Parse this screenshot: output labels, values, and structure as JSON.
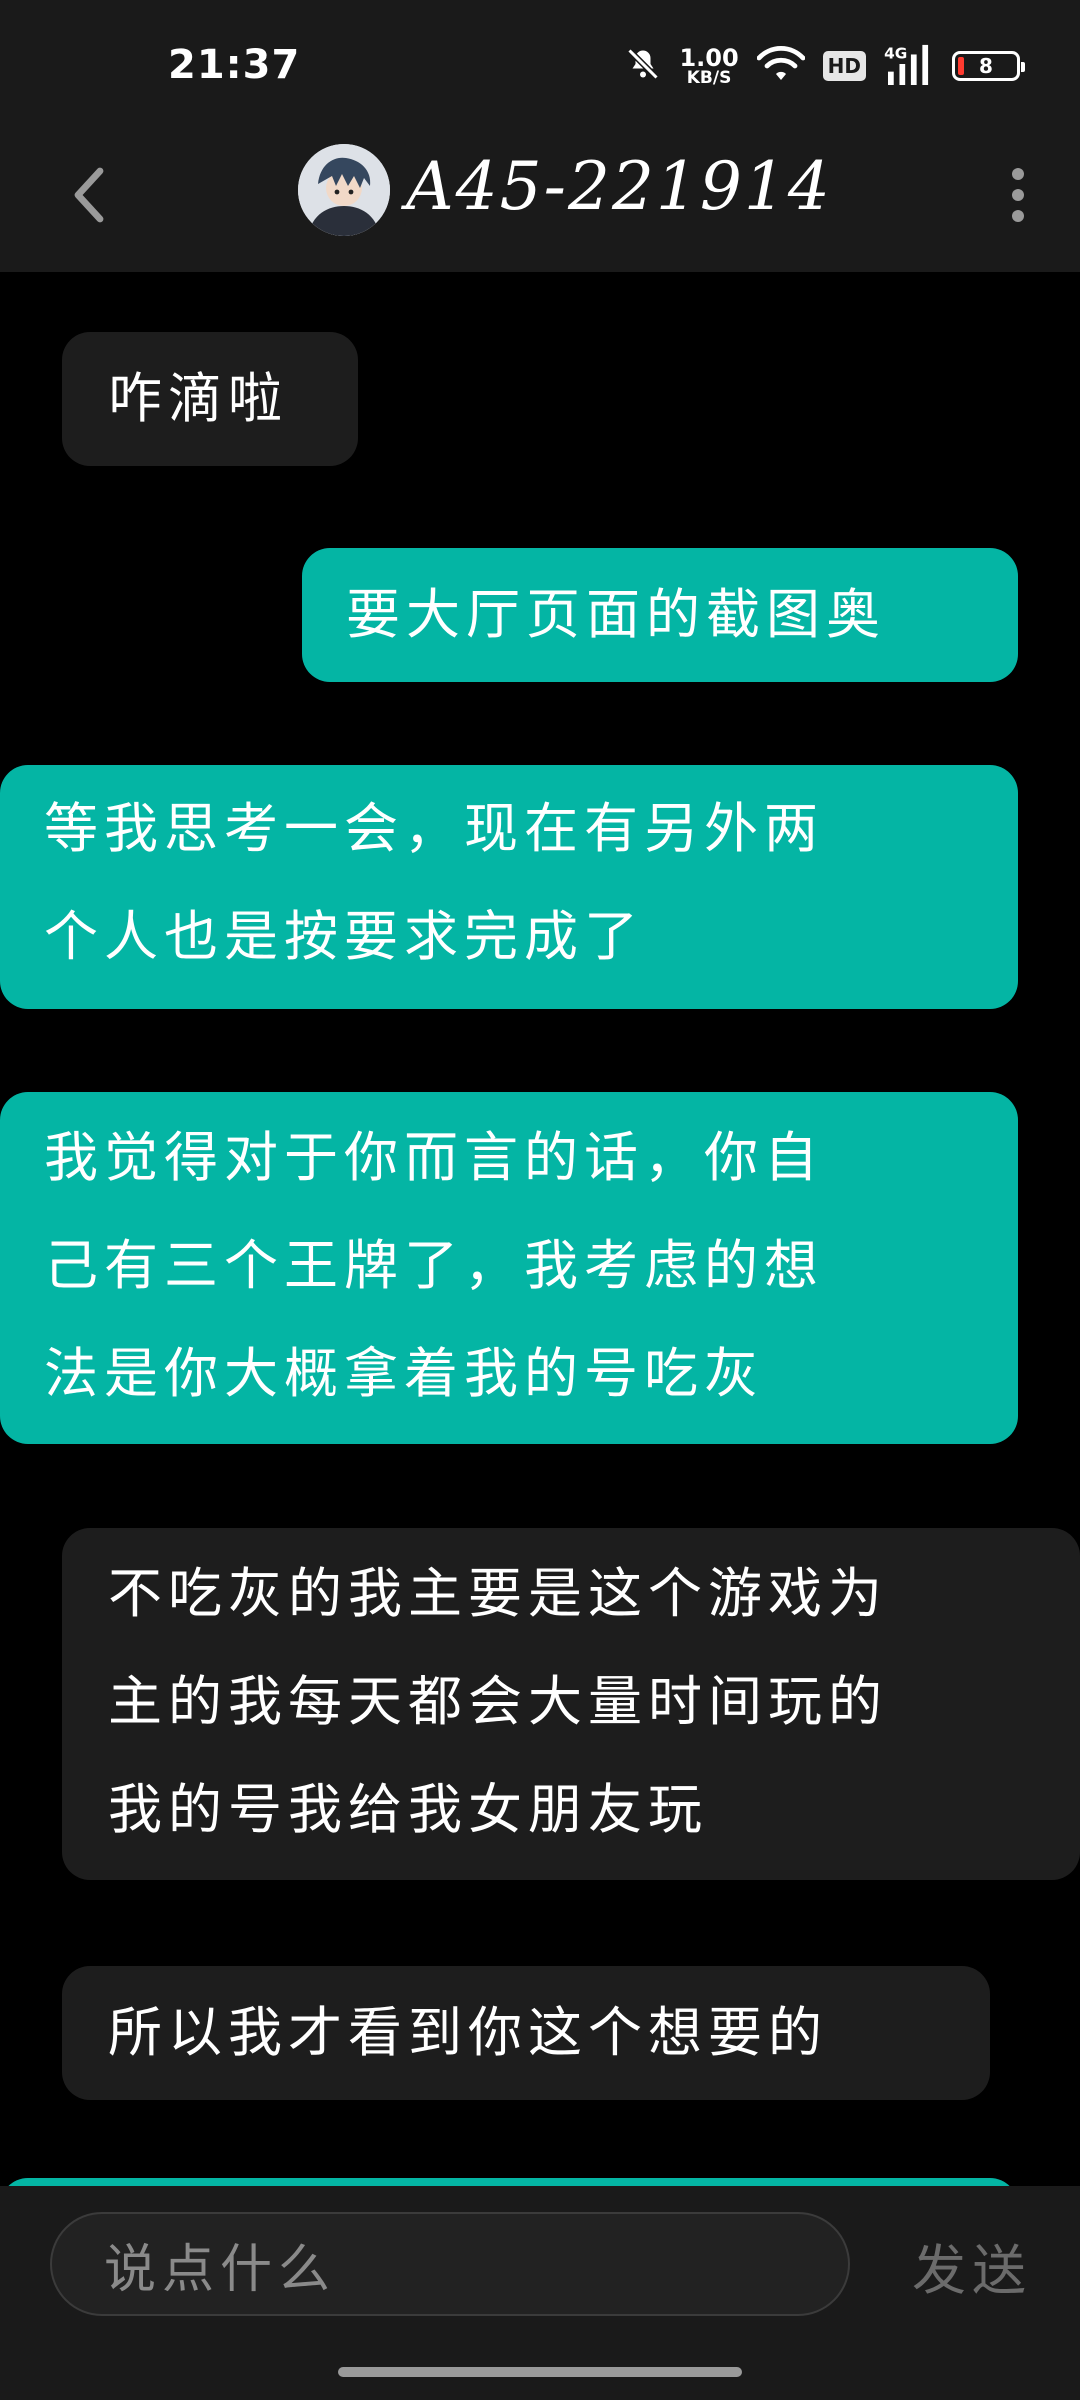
{
  "status_bar": {
    "time": "21:37",
    "net_speed_value": "1.00",
    "net_speed_unit": "KB/S",
    "hd_badge": "HD",
    "network_type": "4G",
    "battery_level": "8",
    "icons": [
      "mute-bell-icon",
      "wifi-icon",
      "signal-icon",
      "battery-icon"
    ]
  },
  "header": {
    "title": "A45-221914",
    "back_icon": "chevron-left-icon",
    "more_icon": "more-vertical-icon"
  },
  "messages": [
    {
      "side": "received",
      "text": "咋滴啦"
    },
    {
      "side": "sent",
      "text": "要大厅页面的截图奥"
    },
    {
      "side": "sent",
      "lines": [
        "等我思考一会，现在有另外两",
        "个人也是按要求完成了"
      ]
    },
    {
      "side": "sent",
      "lines": [
        "我觉得对于你而言的话，你自",
        "己有三个王牌了，我考虑的想",
        "法是你大概拿着我的号吃灰"
      ]
    },
    {
      "side": "received",
      "lines": [
        "不吃灰的我主要是这个游戏为",
        "主的我每天都会大量时间玩的",
        "我的号我给我女朋友玩"
      ]
    },
    {
      "side": "received",
      "text": "所以我才看到你这个想要的"
    }
  ],
  "composer": {
    "placeholder": "说点什么",
    "send_label": "发送"
  },
  "colors": {
    "sent_bubble": "#04b5a4",
    "received_bubble": "#1d1d1d",
    "bar_background": "#1a1a1a",
    "page_background": "#000000"
  }
}
